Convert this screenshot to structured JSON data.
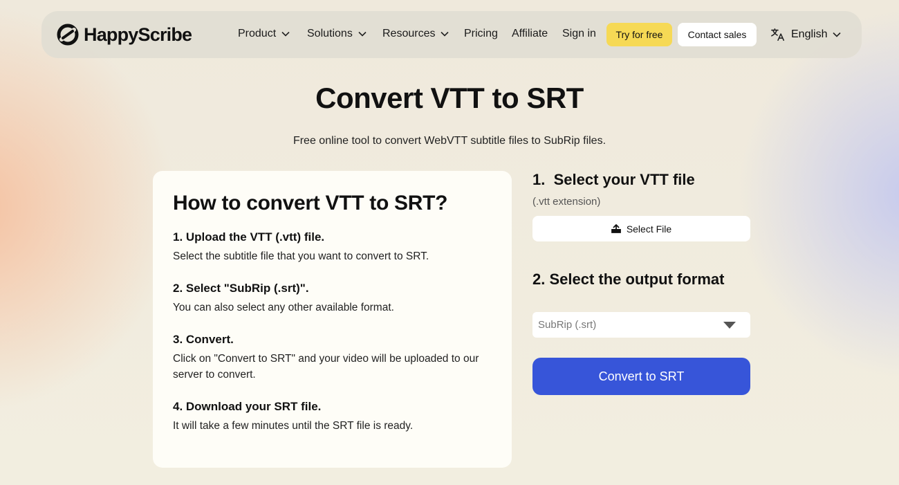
{
  "brand": {
    "name": "HappyScribe"
  },
  "nav": {
    "items": [
      {
        "label": "Product",
        "dropdown": true
      },
      {
        "label": "Solutions",
        "dropdown": true
      },
      {
        "label": "Resources",
        "dropdown": true
      },
      {
        "label": "Pricing",
        "dropdown": false
      },
      {
        "label": "Affiliate",
        "dropdown": false
      },
      {
        "label": "Sign in",
        "dropdown": false
      }
    ],
    "try_label": "Try for free",
    "contact_label": "Contact sales",
    "language_label": "English"
  },
  "hero": {
    "title": "Convert VTT to SRT",
    "subtitle": "Free online tool to convert WebVTT subtitle files to SubRip files."
  },
  "howto": {
    "title": "How to convert VTT to SRT?",
    "steps": [
      {
        "heading": "1. Upload the VTT (.vtt) file.",
        "text": "Select the subtitle file that you want to convert to SRT."
      },
      {
        "heading": "2. Select \"SubRip (.srt)\".",
        "text": "You can also select any other available format."
      },
      {
        "heading": "3. Convert.",
        "text": "Click on \"Convert to SRT\" and your video will be uploaded to our server to convert."
      },
      {
        "heading": "4. Download your SRT file.",
        "text": "It will take a few minutes until the SRT file is ready."
      }
    ]
  },
  "converter": {
    "step1_title": "1.  Select your VTT file",
    "step1_note": "(.vtt extension)",
    "select_file_label": "Select File",
    "step2_title": "2.  Select the output format",
    "output_format": "SubRip (.srt)",
    "convert_label": "Convert to SRT"
  },
  "colors": {
    "accent": "#3755d9",
    "try_button": "#f6d955"
  },
  "icons": {
    "logo": "happyscribe-logo-icon",
    "chevron": "chevron-down-icon",
    "language": "translate-icon",
    "upload": "upload-icon",
    "select": "triangle-down-icon"
  }
}
